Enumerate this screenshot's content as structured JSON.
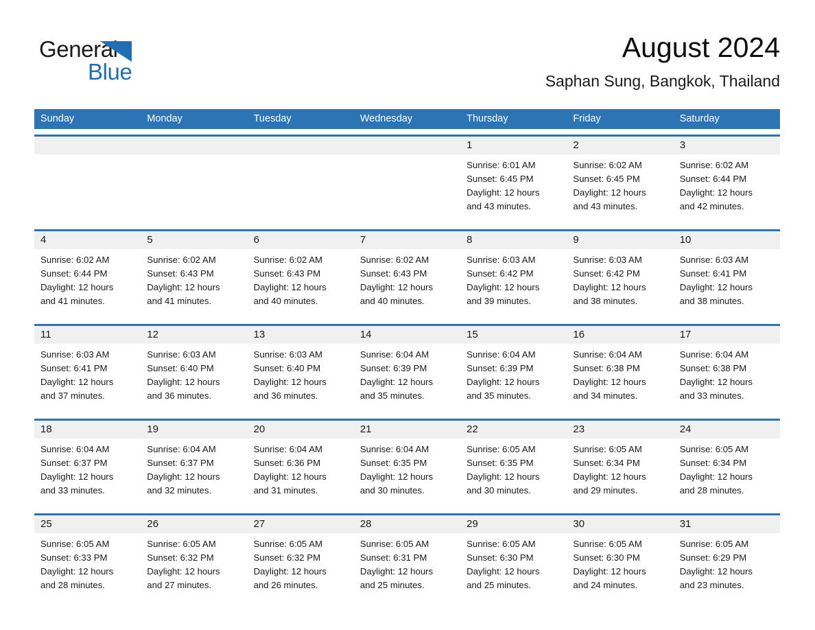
{
  "brand": {
    "name_part1": "General",
    "name_part2": "Blue",
    "triangle_color": "#1f6fb2"
  },
  "header": {
    "month_title": "August 2024",
    "location": "Saphan Sung, Bangkok, Thailand"
  },
  "theme": {
    "header_blue": "#2c74b3",
    "date_band_gray": "#f0f0f0",
    "cell_white": "#ffffff",
    "text_dark": "#1a1a1a"
  },
  "weekdays": [
    "Sunday",
    "Monday",
    "Tuesday",
    "Wednesday",
    "Thursday",
    "Friday",
    "Saturday"
  ],
  "weeks": [
    {
      "days": [
        {
          "date": "",
          "sunrise": "",
          "sunset": "",
          "daylight_line1": "",
          "daylight_line2": ""
        },
        {
          "date": "",
          "sunrise": "",
          "sunset": "",
          "daylight_line1": "",
          "daylight_line2": ""
        },
        {
          "date": "",
          "sunrise": "",
          "sunset": "",
          "daylight_line1": "",
          "daylight_line2": ""
        },
        {
          "date": "",
          "sunrise": "",
          "sunset": "",
          "daylight_line1": "",
          "daylight_line2": ""
        },
        {
          "date": "1",
          "sunrise": "Sunrise: 6:01 AM",
          "sunset": "Sunset: 6:45 PM",
          "daylight_line1": "Daylight: 12 hours",
          "daylight_line2": "and 43 minutes."
        },
        {
          "date": "2",
          "sunrise": "Sunrise: 6:02 AM",
          "sunset": "Sunset: 6:45 PM",
          "daylight_line1": "Daylight: 12 hours",
          "daylight_line2": "and 43 minutes."
        },
        {
          "date": "3",
          "sunrise": "Sunrise: 6:02 AM",
          "sunset": "Sunset: 6:44 PM",
          "daylight_line1": "Daylight: 12 hours",
          "daylight_line2": "and 42 minutes."
        }
      ]
    },
    {
      "days": [
        {
          "date": "4",
          "sunrise": "Sunrise: 6:02 AM",
          "sunset": "Sunset: 6:44 PM",
          "daylight_line1": "Daylight: 12 hours",
          "daylight_line2": "and 41 minutes."
        },
        {
          "date": "5",
          "sunrise": "Sunrise: 6:02 AM",
          "sunset": "Sunset: 6:43 PM",
          "daylight_line1": "Daylight: 12 hours",
          "daylight_line2": "and 41 minutes."
        },
        {
          "date": "6",
          "sunrise": "Sunrise: 6:02 AM",
          "sunset": "Sunset: 6:43 PM",
          "daylight_line1": "Daylight: 12 hours",
          "daylight_line2": "and 40 minutes."
        },
        {
          "date": "7",
          "sunrise": "Sunrise: 6:02 AM",
          "sunset": "Sunset: 6:43 PM",
          "daylight_line1": "Daylight: 12 hours",
          "daylight_line2": "and 40 minutes."
        },
        {
          "date": "8",
          "sunrise": "Sunrise: 6:03 AM",
          "sunset": "Sunset: 6:42 PM",
          "daylight_line1": "Daylight: 12 hours",
          "daylight_line2": "and 39 minutes."
        },
        {
          "date": "9",
          "sunrise": "Sunrise: 6:03 AM",
          "sunset": "Sunset: 6:42 PM",
          "daylight_line1": "Daylight: 12 hours",
          "daylight_line2": "and 38 minutes."
        },
        {
          "date": "10",
          "sunrise": "Sunrise: 6:03 AM",
          "sunset": "Sunset: 6:41 PM",
          "daylight_line1": "Daylight: 12 hours",
          "daylight_line2": "and 38 minutes."
        }
      ]
    },
    {
      "days": [
        {
          "date": "11",
          "sunrise": "Sunrise: 6:03 AM",
          "sunset": "Sunset: 6:41 PM",
          "daylight_line1": "Daylight: 12 hours",
          "daylight_line2": "and 37 minutes."
        },
        {
          "date": "12",
          "sunrise": "Sunrise: 6:03 AM",
          "sunset": "Sunset: 6:40 PM",
          "daylight_line1": "Daylight: 12 hours",
          "daylight_line2": "and 36 minutes."
        },
        {
          "date": "13",
          "sunrise": "Sunrise: 6:03 AM",
          "sunset": "Sunset: 6:40 PM",
          "daylight_line1": "Daylight: 12 hours",
          "daylight_line2": "and 36 minutes."
        },
        {
          "date": "14",
          "sunrise": "Sunrise: 6:04 AM",
          "sunset": "Sunset: 6:39 PM",
          "daylight_line1": "Daylight: 12 hours",
          "daylight_line2": "and 35 minutes."
        },
        {
          "date": "15",
          "sunrise": "Sunrise: 6:04 AM",
          "sunset": "Sunset: 6:39 PM",
          "daylight_line1": "Daylight: 12 hours",
          "daylight_line2": "and 35 minutes."
        },
        {
          "date": "16",
          "sunrise": "Sunrise: 6:04 AM",
          "sunset": "Sunset: 6:38 PM",
          "daylight_line1": "Daylight: 12 hours",
          "daylight_line2": "and 34 minutes."
        },
        {
          "date": "17",
          "sunrise": "Sunrise: 6:04 AM",
          "sunset": "Sunset: 6:38 PM",
          "daylight_line1": "Daylight: 12 hours",
          "daylight_line2": "and 33 minutes."
        }
      ]
    },
    {
      "days": [
        {
          "date": "18",
          "sunrise": "Sunrise: 6:04 AM",
          "sunset": "Sunset: 6:37 PM",
          "daylight_line1": "Daylight: 12 hours",
          "daylight_line2": "and 33 minutes."
        },
        {
          "date": "19",
          "sunrise": "Sunrise: 6:04 AM",
          "sunset": "Sunset: 6:37 PM",
          "daylight_line1": "Daylight: 12 hours",
          "daylight_line2": "and 32 minutes."
        },
        {
          "date": "20",
          "sunrise": "Sunrise: 6:04 AM",
          "sunset": "Sunset: 6:36 PM",
          "daylight_line1": "Daylight: 12 hours",
          "daylight_line2": "and 31 minutes."
        },
        {
          "date": "21",
          "sunrise": "Sunrise: 6:04 AM",
          "sunset": "Sunset: 6:35 PM",
          "daylight_line1": "Daylight: 12 hours",
          "daylight_line2": "and 30 minutes."
        },
        {
          "date": "22",
          "sunrise": "Sunrise: 6:05 AM",
          "sunset": "Sunset: 6:35 PM",
          "daylight_line1": "Daylight: 12 hours",
          "daylight_line2": "and 30 minutes."
        },
        {
          "date": "23",
          "sunrise": "Sunrise: 6:05 AM",
          "sunset": "Sunset: 6:34 PM",
          "daylight_line1": "Daylight: 12 hours",
          "daylight_line2": "and 29 minutes."
        },
        {
          "date": "24",
          "sunrise": "Sunrise: 6:05 AM",
          "sunset": "Sunset: 6:34 PM",
          "daylight_line1": "Daylight: 12 hours",
          "daylight_line2": "and 28 minutes."
        }
      ]
    },
    {
      "days": [
        {
          "date": "25",
          "sunrise": "Sunrise: 6:05 AM",
          "sunset": "Sunset: 6:33 PM",
          "daylight_line1": "Daylight: 12 hours",
          "daylight_line2": "and 28 minutes."
        },
        {
          "date": "26",
          "sunrise": "Sunrise: 6:05 AM",
          "sunset": "Sunset: 6:32 PM",
          "daylight_line1": "Daylight: 12 hours",
          "daylight_line2": "and 27 minutes."
        },
        {
          "date": "27",
          "sunrise": "Sunrise: 6:05 AM",
          "sunset": "Sunset: 6:32 PM",
          "daylight_line1": "Daylight: 12 hours",
          "daylight_line2": "and 26 minutes."
        },
        {
          "date": "28",
          "sunrise": "Sunrise: 6:05 AM",
          "sunset": "Sunset: 6:31 PM",
          "daylight_line1": "Daylight: 12 hours",
          "daylight_line2": "and 25 minutes."
        },
        {
          "date": "29",
          "sunrise": "Sunrise: 6:05 AM",
          "sunset": "Sunset: 6:30 PM",
          "daylight_line1": "Daylight: 12 hours",
          "daylight_line2": "and 25 minutes."
        },
        {
          "date": "30",
          "sunrise": "Sunrise: 6:05 AM",
          "sunset": "Sunset: 6:30 PM",
          "daylight_line1": "Daylight: 12 hours",
          "daylight_line2": "and 24 minutes."
        },
        {
          "date": "31",
          "sunrise": "Sunrise: 6:05 AM",
          "sunset": "Sunset: 6:29 PM",
          "daylight_line1": "Daylight: 12 hours",
          "daylight_line2": "and 23 minutes."
        }
      ]
    }
  ]
}
